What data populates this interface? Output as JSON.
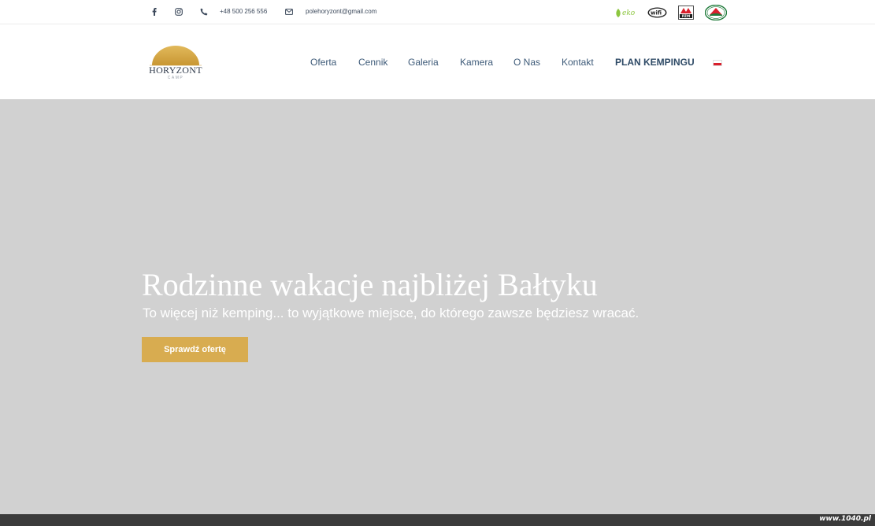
{
  "topbar": {
    "icons": {
      "facebook": "facebook-icon",
      "instagram": "instagram-icon",
      "phone": "phone-icon",
      "email": "email-icon"
    },
    "phone": "+48 500 256 556",
    "email": "polehoryzont@gmail.com",
    "badges": {
      "eko": "eko",
      "wifi": "wifi",
      "pzm": "PZM",
      "camping": "camping-badge"
    }
  },
  "header": {
    "logo": {
      "name": "HORYZONT",
      "sub": "CAMP"
    },
    "nav": [
      {
        "label": "Oferta"
      },
      {
        "label": "Cennik"
      },
      {
        "label": "Galeria"
      },
      {
        "label": "Kamera"
      },
      {
        "label": "O Nas"
      },
      {
        "label": "Kontakt"
      },
      {
        "label": "PLAN KEMPINGU"
      }
    ],
    "language_flag": "polish-flag-icon"
  },
  "hero": {
    "title": "Rodzinne wakacje najbliżej Bałtyku",
    "subtitle": "To więcej niż kemping... to wyjątkowe miejsce, do którego zawsze będziesz wracać.",
    "button_label": "Sprawdź ofertę"
  },
  "watermark": "www.1040.pl",
  "colors": {
    "accent": "#d8ac50",
    "nav_text": "#3d5a78",
    "hero_bg": "#d1d1d1",
    "footer_strip": "#3b3b3b"
  }
}
